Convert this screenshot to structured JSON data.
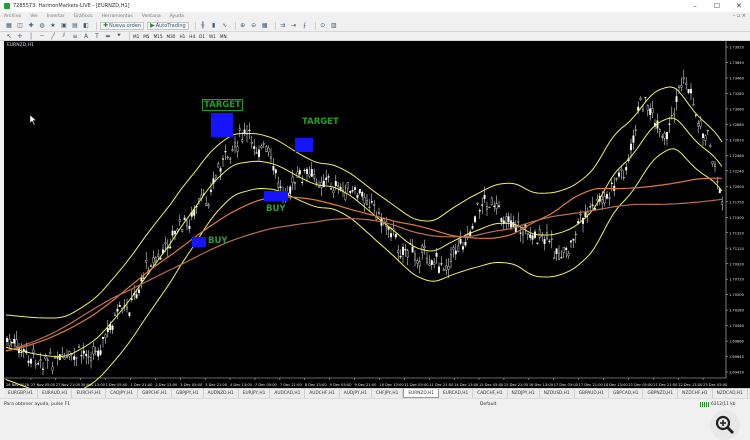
{
  "window": {
    "title": "7285573: HarmonMarkets-LIVE - [EURNZD,H1]",
    "minimize_icon": "minimize-icon",
    "maximize_icon": "maximize-icon",
    "close_icon": "close-icon"
  },
  "menubar": {
    "items": [
      "Archivo",
      "Ver",
      "Insertar",
      "Gráficos",
      "Herramientas",
      "Ventana",
      "Ayuda"
    ]
  },
  "toolbar": {
    "new_order_label": "Nueva orden",
    "autotrading_label": "AutoTrading",
    "timeframes": [
      "M1",
      "M5",
      "M15",
      "M30",
      "H1",
      "H4",
      "D1",
      "W1",
      "MN"
    ]
  },
  "chart": {
    "symbol_label": "EURNZD,H1",
    "background": "#000000",
    "candle_color": "#ffffff",
    "band_color": "#f2f25a",
    "ma_color": "#e07b39",
    "marker_color": "#1414ff",
    "label_color": "#1ea01e",
    "annotations": {
      "target1": "TARGET",
      "target2": "TARGET",
      "buy1": "BUY",
      "buy2": "BUY"
    },
    "price_ticks": [
      "1.73920",
      "1.73640",
      "1.73460",
      "1.73280",
      "1.73080",
      "1.72880",
      "1.72670",
      "1.72460",
      "1.72240",
      "1.72000",
      "1.71750",
      "1.71500",
      "1.71320",
      "1.71120",
      "1.70920",
      "1.70720",
      "1.70500",
      "1.70280",
      "1.70060",
      "1.69860",
      "1.69640",
      "1.69420"
    ],
    "time_ticks": [
      "26 Nov 2020",
      "27 Nov 05:00",
      "27 Nov 21:00",
      "30 Nov 13:00",
      "1 Dec 05:00",
      "1 Dec 21:00",
      "2 Dec 13:00",
      "3 Dec 05:00",
      "3 Dec 21:00",
      "4 Dec 13:00",
      "7 Dec 05:00",
      "7 Dec 21:00",
      "8 Dec 13:00",
      "9 Dec 05:00",
      "9 Dec 21:00",
      "10 Dec 13:00",
      "11 Dec 05:00",
      "11 Dec 21:00",
      "14 Dec 13:00",
      "15 Dec 05:00",
      "15 Dec 21:00",
      "16 Dec 13:00",
      "17 Dec 05:00",
      "17 Dec 21:00",
      "18 Dec 13:00",
      "21 Dec 05:00",
      "21 Dec 21:00",
      "22 Dec 13:00",
      "23 Dec 05:00"
    ]
  },
  "tabs": [
    "EURGBP,H1",
    "EURAUD,H1",
    "EURCHF,H1",
    "CADJPY,H1",
    "GBPCHF,H1",
    "GBPJPY,H1",
    "AUDNZD,H1",
    "EURJPY,H1",
    "AUDCAD,H1",
    "AUDCHF,H1",
    "AUDJPY,H1",
    "CHFJPY,H1",
    "EURNZD,H1",
    "EURCAD,H1",
    "CADCHF,H1",
    "NZDJPY,H1",
    "NZDUSD,H1",
    "GBPAUD,H1",
    "GBPCAD,H1",
    "GBPNZD,H1",
    "NZDCHF,H1",
    "NZDCAD,H1",
    "GBPUSD,H1"
  ],
  "active_tab": "EURNZD,H1",
  "status": {
    "help": "Para obtener ayuda, pulse F1",
    "profile": "Default",
    "connection": "6312/11 kb"
  },
  "zoom_overlay_icon": "magnifier-zoom-icon"
}
